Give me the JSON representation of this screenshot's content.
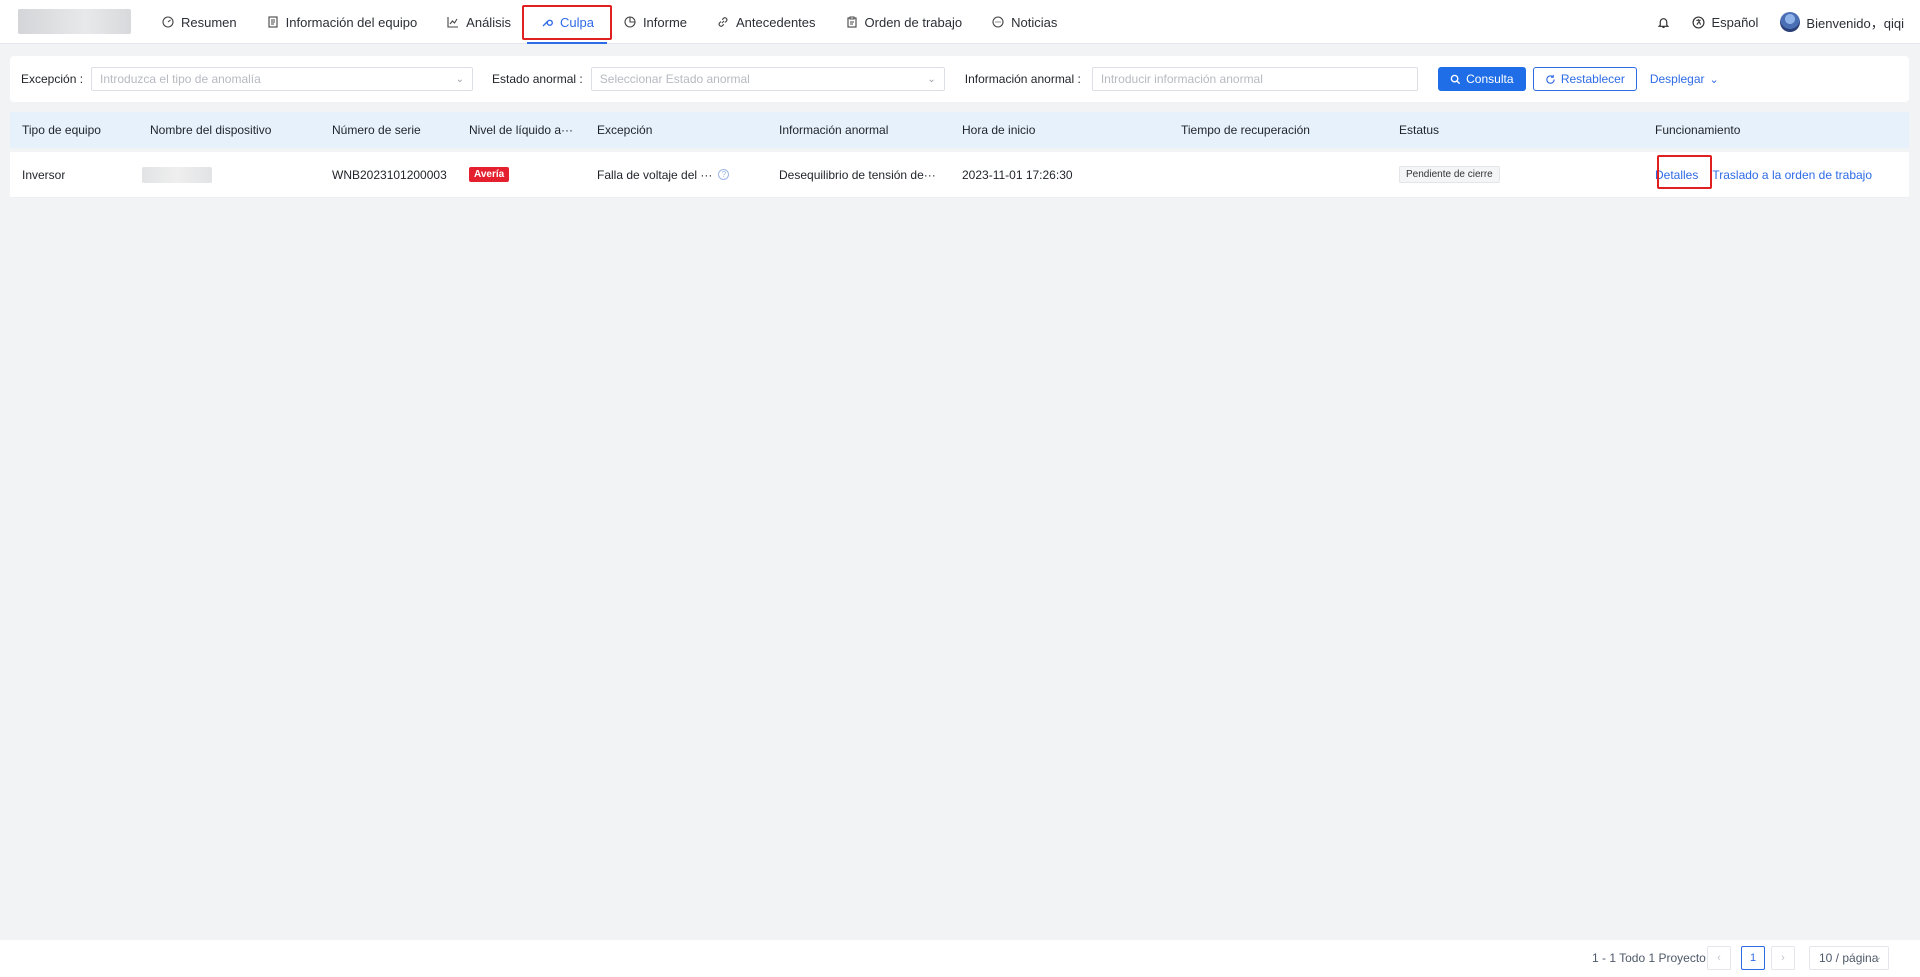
{
  "nav": {
    "items": [
      {
        "label": "Resumen",
        "icon": "dashboard-icon"
      },
      {
        "label": "Información del equipo",
        "icon": "document-icon"
      },
      {
        "label": "Análisis",
        "icon": "line-chart-icon"
      },
      {
        "label": "Culpa",
        "icon": "wrench-icon",
        "active": true
      },
      {
        "label": "Informe",
        "icon": "pie-chart-icon"
      },
      {
        "label": "Antecedentes",
        "icon": "link-icon"
      },
      {
        "label": "Orden de trabajo",
        "icon": "clipboard-icon"
      },
      {
        "label": "Noticias",
        "icon": "message-icon"
      }
    ],
    "language": "Español",
    "welcome": "Bienvenido，qiqi"
  },
  "filters": {
    "exception_label": "Excepción :",
    "exception_placeholder": "Introduzca el tipo de anomalía",
    "state_label": "Estado anormal :",
    "state_placeholder": "Seleccionar Estado anormal",
    "info_label": "Información anormal :",
    "info_placeholder": "Introducir información anormal",
    "query_button": "Consulta",
    "reset_button": "Restablecer",
    "expand_button": "Desplegar"
  },
  "table": {
    "headers": {
      "equipment_type": "Tipo de equipo",
      "device_name": "Nombre del dispositivo",
      "serial_number": "Número de serie",
      "level": "Nivel de líquido a···",
      "exception": "Excepción",
      "abnormal_info": "Información anormal",
      "start_time": "Hora de inicio",
      "recovery_time": "Tiempo de recuperación",
      "status": "Estatus",
      "operation": "Funcionamiento"
    },
    "rows": [
      {
        "equipment_type": "Inversor",
        "serial_number": "WNB2023101200003",
        "level": "Avería",
        "exception": "Falla de voltaje del ···",
        "abnormal_info": "Desequilibrio de tensión de···",
        "start_time": "2023-11-01 17:26:30",
        "recovery_time": "",
        "status": "Pendiente de cierre",
        "details_link": "Detalles",
        "transfer_link": "Traslado a la orden de trabajo"
      }
    ]
  },
  "pagination": {
    "total_text": "1 - 1 Todo 1 Proyecto",
    "current_page": "1",
    "page_size": "10 / página"
  },
  "colors": {
    "accent": "#2e6be6",
    "danger": "#e5202e",
    "highlight": "#e02020"
  }
}
